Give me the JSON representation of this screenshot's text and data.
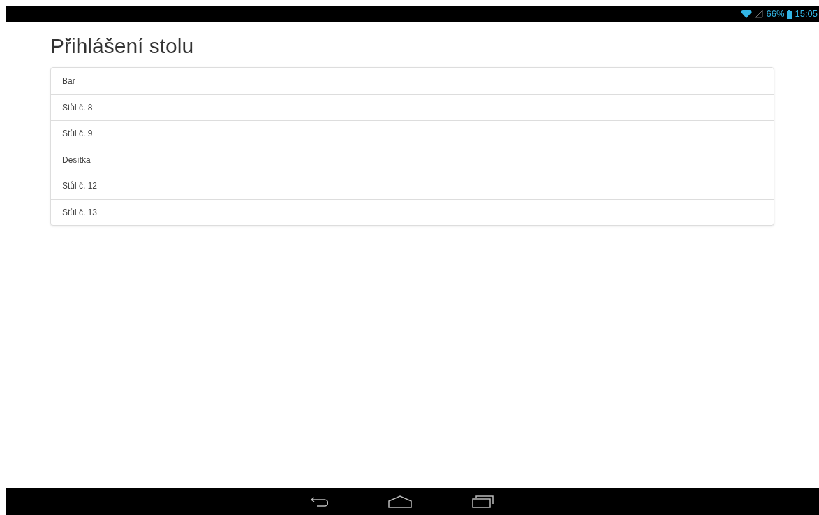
{
  "status_bar": {
    "battery": "66%",
    "time": "15:05"
  },
  "title": "Přihlášení stolu",
  "tables": [
    {
      "label": "Bar"
    },
    {
      "label": "Stůl č. 8"
    },
    {
      "label": "Stůl č. 9"
    },
    {
      "label": "Desítka"
    },
    {
      "label": "Stůl č. 12"
    },
    {
      "label": "Stůl č. 13"
    }
  ]
}
